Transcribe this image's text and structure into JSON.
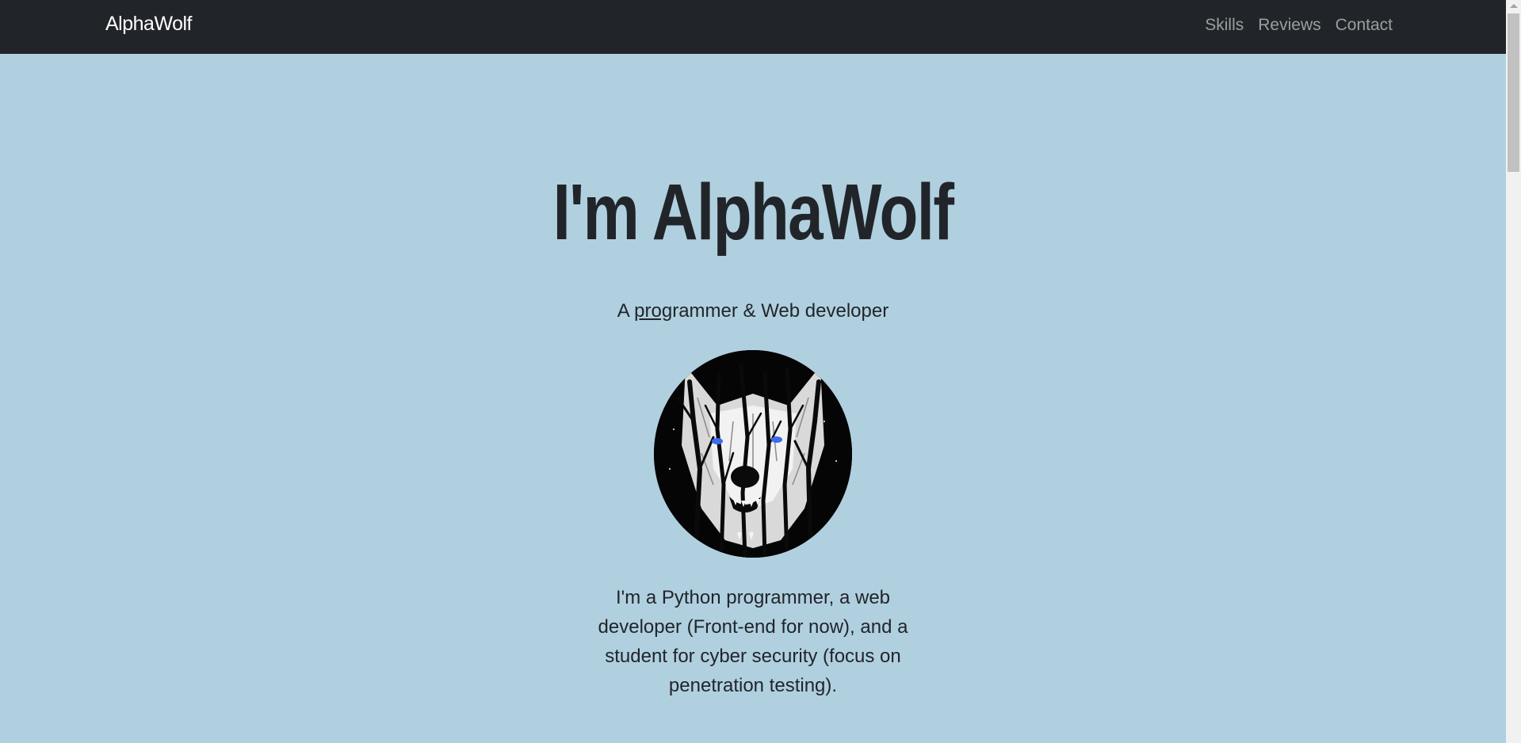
{
  "navbar": {
    "brand": "AlphaWolf",
    "links": [
      {
        "label": "Skills"
      },
      {
        "label": "Reviews"
      },
      {
        "label": "Contact"
      }
    ]
  },
  "hero": {
    "title": "I'm AlphaWolf",
    "subtitle_prefix": "A ",
    "subtitle_underlined": "prog",
    "subtitle_suffix": "rammer & Web developer",
    "bio": "I'm a Python programmer, a web developer (Front-end for now), and a student for cyber security (focus on penetration testing)."
  },
  "colors": {
    "navbar_bg": "#212529",
    "page_bg": "#b0d0e0",
    "text": "#212529",
    "wolf_eyes": "#3a6cf0"
  }
}
